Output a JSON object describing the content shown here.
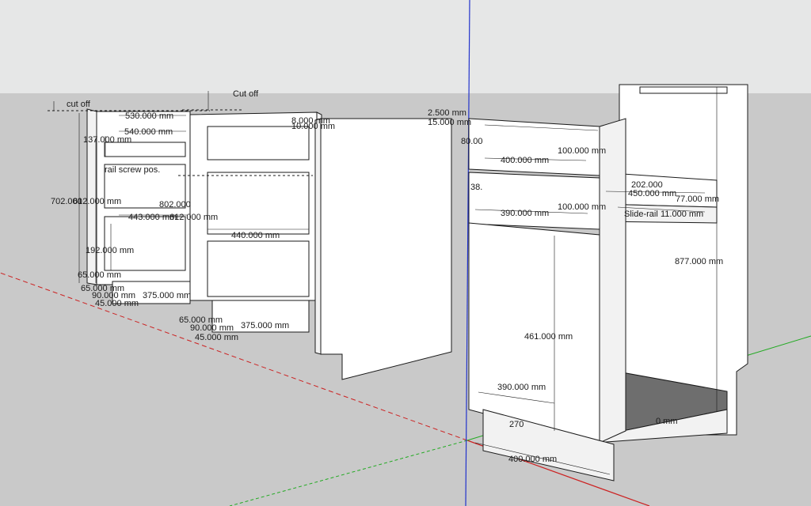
{
  "colors": {
    "sky": "#e6e7e7",
    "ground": "#c9c9c9",
    "panel": "#ffffff",
    "panel_shade": "#f2f2f2",
    "edge": "#1a1a1a",
    "floor": "#6e6e6e",
    "axis_red": "#cc2222",
    "axis_green": "#22aa22",
    "axis_blue": "#2233cc"
  },
  "annotations": {
    "cut_off_left": "cut off",
    "cut_off_right": "Cut off",
    "rail_screw": "rail screw pos.",
    "slide_rail": "Slide-rail"
  },
  "dimensions": {
    "d530": "530.000 mm",
    "d540": "540.000 mm",
    "d137": "137.000 mm",
    "d702": "702.000",
    "d612": "612.000 mm",
    "d443": "443.000 mm",
    "d802": "802.000",
    "d612b": "612.000 mm",
    "d192": "192.000 mm",
    "d65a": "65.000 mm",
    "d65b": "65.000 mm",
    "d90a": "90.000 mm",
    "d375a": "375.000 mm",
    "d45a": "45.000 mm",
    "d440": "440.000 mm",
    "d65c": "65.000 mm",
    "d90b": "90.000 mm",
    "d375b": "375.000 mm",
    "d45b": "45.000 mm",
    "d8": "8.000 mm",
    "d10": "10.000 mm",
    "d2_5": "2.500 mm",
    "d15": "15.000 mm",
    "d80": "80.00",
    "d400a": "400.000 mm",
    "d100a": "100.000 mm",
    "d38": "38.",
    "d390a": "390.000 mm",
    "d100b": "100.000 mm",
    "d202": "202.000",
    "d450": "450.000 mm",
    "d77": "77.000 mm",
    "d11": "11.000 mm",
    "d877": "877.000 mm",
    "d461": "461.000 mm",
    "d390b": "390.000 mm",
    "d270": "270",
    "d400b": "400.000 mm",
    "d_mm": "0 mm"
  }
}
